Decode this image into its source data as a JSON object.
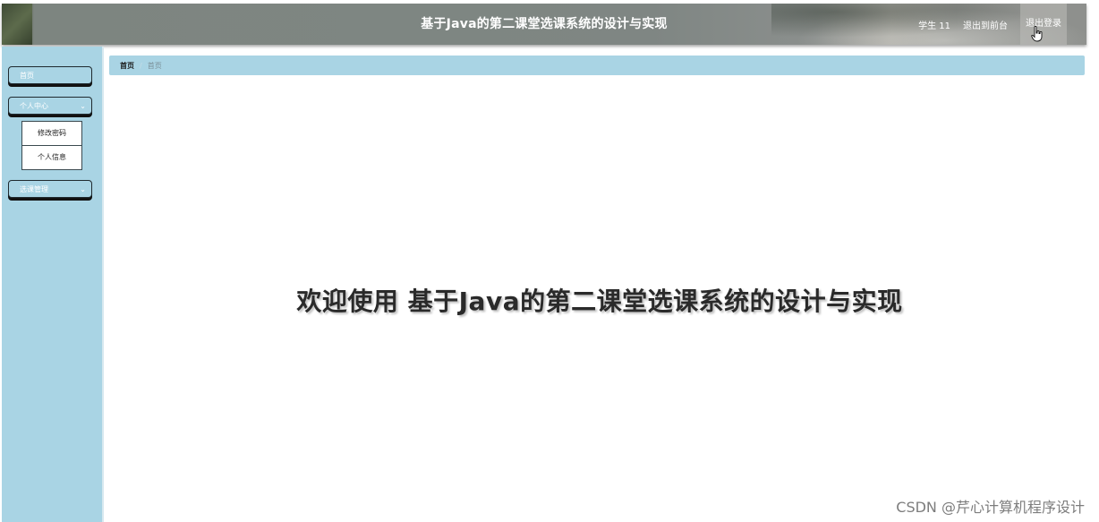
{
  "header": {
    "title": "基于Java的第二课堂选课系统的设计与实现",
    "user_label": "学生 11",
    "front_link": "退出到前台",
    "logout_link": "退出登录"
  },
  "sidebar": {
    "items": [
      {
        "label": "首页"
      },
      {
        "label": "个人中心",
        "children": [
          "修改密码",
          "个人信息"
        ]
      },
      {
        "label": "选课管理"
      }
    ]
  },
  "breadcrumb": {
    "home": "首页",
    "separator": "/",
    "current": "首页"
  },
  "main": {
    "welcome": "欢迎使用 基于Java的第二课堂选课系统的设计与实现"
  },
  "watermark": "CSDN @芹心计算机程序设计",
  "colors": {
    "accent": "#a9d4e4",
    "header_bg": "#7f8683"
  }
}
